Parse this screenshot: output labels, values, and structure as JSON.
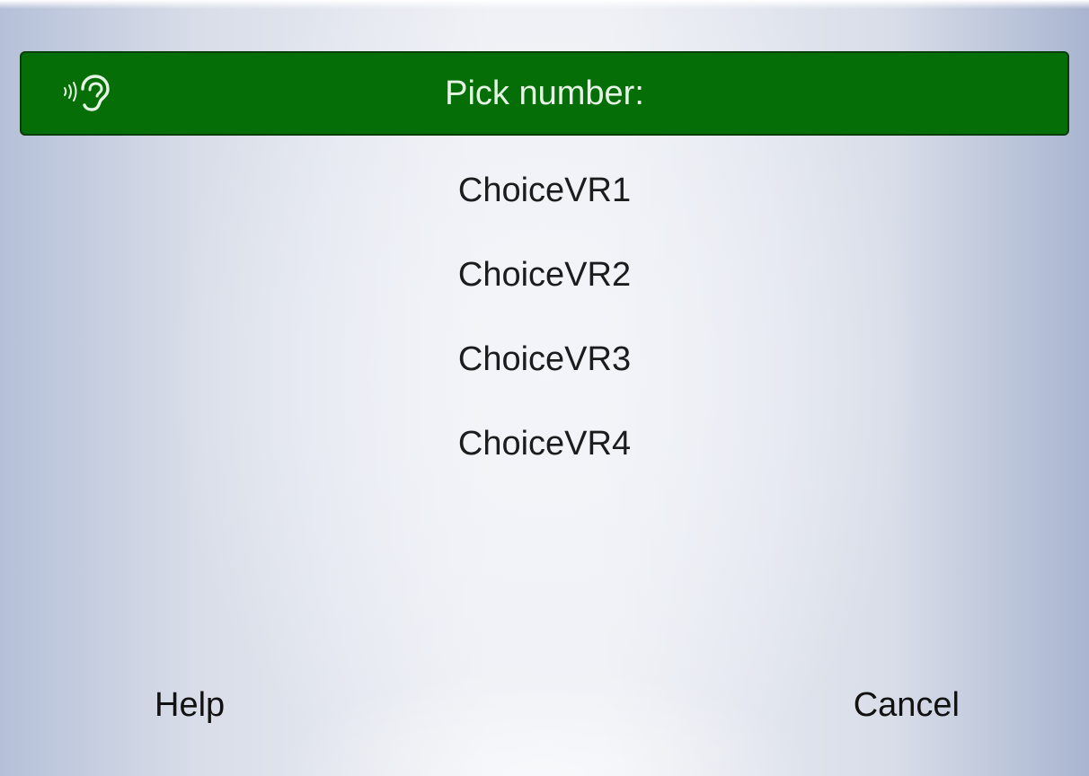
{
  "header": {
    "title": "Pick number:",
    "icon": "listening-ear-icon",
    "color": "#066e06"
  },
  "choices": [
    {
      "label": "ChoiceVR1"
    },
    {
      "label": "ChoiceVR2"
    },
    {
      "label": "ChoiceVR3"
    },
    {
      "label": "ChoiceVR4"
    }
  ],
  "softkeys": {
    "left": "Help",
    "right": "Cancel"
  }
}
